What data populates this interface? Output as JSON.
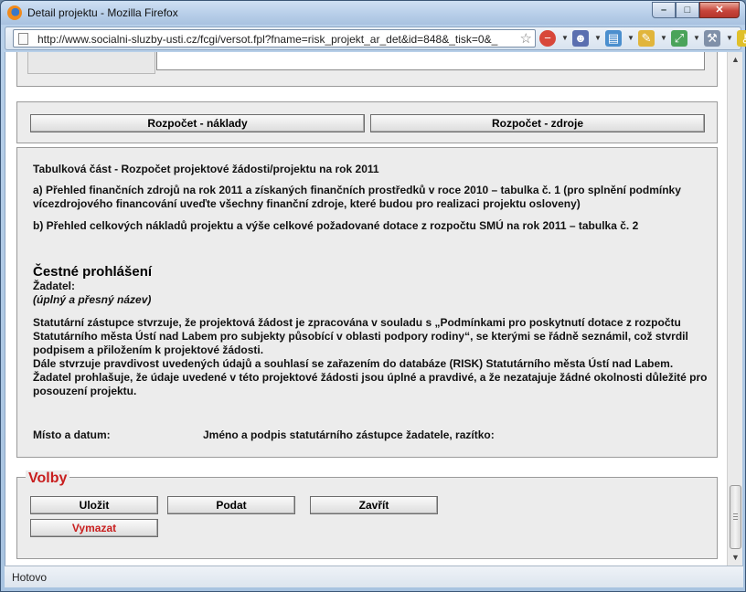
{
  "window": {
    "title": "Detail projektu - Mozilla Firefox",
    "url": "http://www.socialni-sluzby-usti.cz/fcgi/versot.fpl?fname=risk_projekt_ar_det&id=848&_tisk=0&_",
    "status": "Hotovo"
  },
  "buttons": {
    "naklady": "Rozpočet - náklady",
    "zdroje": "Rozpočet - zdroje"
  },
  "info": {
    "heading": "Tabulková část - Rozpočet projektové žádosti/projektu na rok 2011",
    "item_a": "a) Přehled finančních zdrojů na rok 2011 a získaných finančních prostředků v roce 2010 – tabulka č. 1 (pro splnění podmínky vícezdrojového financování uveďte všechny finanční zdroje, které budou pro realizaci projektu osloveny)",
    "item_b": "b) Přehled celkových nákladů projektu a výše celkové požadované dotace z rozpočtu SMÚ na rok 2011 – tabulka č. 2",
    "declaration_title": "Čestné prohlášení",
    "applicant_label": "Žadatel:",
    "applicant_note": "(úplný a přesný název)",
    "declaration_text": "Statutární zástupce stvrzuje, že projektová žádost je zpracována v souladu s „Podmínkami pro poskytnutí dotace z rozpočtu Statutárního města Ústí nad Labem pro subjekty působící v oblasti podpory rodiny“, se kterými se řádně seznámil, což stvrdil podpisem a přiložením k projektové žádosti.",
    "declaration_text2": "Dále stvrzuje pravdivost uvedených údajů a souhlasí se zařazením do databáze (RISK) Statutárního města Ústí nad Labem.",
    "declaration_text3": "Žadatel prohlašuje, že údaje uvedené v této projektové žádosti jsou úplné a pravdivé, a že nezatajuje žádné okolnosti důležité pro posouzení projektu.",
    "place_date": "Místo a datum:",
    "signature": "Jméno a podpis statutárního zástupce žadatele, razítko:"
  },
  "volby": {
    "legend": "Volby",
    "ulozit": "Uložit",
    "podat": "Podat",
    "zavrit": "Zavřít",
    "vymazat": "Vymazat"
  },
  "icons": {
    "firefox": "firefox-icon",
    "star": "bookmark-star-icon"
  }
}
